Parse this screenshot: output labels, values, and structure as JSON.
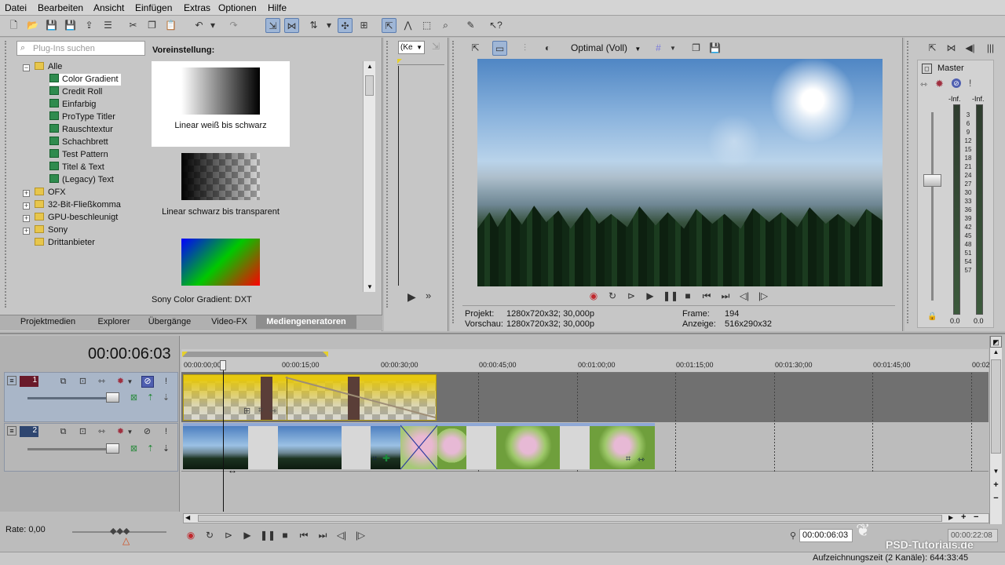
{
  "menu": [
    "Datei",
    "Bearbeiten",
    "Ansicht",
    "Einfügen",
    "Extras",
    "Optionen",
    "Hilfe"
  ],
  "explorer": {
    "search_placeholder": "Plug-Ins suchen",
    "tree_root": "Alle",
    "generators": [
      "Color Gradient",
      "Credit Roll",
      "Einfarbig",
      "ProType Titler",
      "Rauschtextur",
      "Schachbrett",
      "Test Pattern",
      "Titel & Text",
      "(Legacy) Text"
    ],
    "folders": [
      "OFX",
      "32-Bit-Fließkomma",
      "GPU-beschleunigt",
      "Sony",
      "Drittanbieter"
    ],
    "preset_heading": "Voreinstellung:",
    "presets": [
      "Linear weiß bis schwarz",
      "Linear schwarz bis transparent"
    ],
    "plugin_name": "Sony Color Gradient: DXT",
    "tabs": [
      "Projektmedien",
      "Explorer",
      "Übergänge",
      "Video-FX",
      "Mediengeneratoren"
    ],
    "active_tab": "Mediengeneratoren"
  },
  "trimmer": {
    "dropdown_label": "(Ke"
  },
  "preview": {
    "quality": "Optimal (Voll)",
    "projekt_label": "Projekt:",
    "projekt_value": "1280x720x32; 30,000p",
    "vorschau_label": "Vorschau:",
    "vorschau_value": "1280x720x32; 30,000p",
    "frame_label": "Frame:",
    "frame_value": "194",
    "anzeige_label": "Anzeige:",
    "anzeige_value": "516x290x32"
  },
  "mixer": {
    "title": "Master",
    "inf_left": "-Inf.",
    "inf_right": "-Inf.",
    "scale": [
      "3",
      "6",
      "9",
      "12",
      "15",
      "18",
      "21",
      "24",
      "27",
      "30",
      "33",
      "36",
      "39",
      "42",
      "45",
      "48",
      "51",
      "54",
      "57"
    ],
    "bottom_left": "0.0",
    "bottom_right": "0.0"
  },
  "timeline": {
    "timecode": "00:00:06:03",
    "ruler": [
      "00:00:00;00",
      "00:00:15;00",
      "00:00:30;00",
      "00:00:45;00",
      "00:01:00;00",
      "00:01:15;00",
      "00:01:30;00",
      "00:01:45;00",
      "00:02"
    ],
    "track1_number": "1",
    "track2_number": "2",
    "rate_label": "Rate: 0,00",
    "position_time": "00:00:06:03",
    "end_time": "00:00:22:08",
    "status": "Aufzeichnungszeit (2 Kanäle): 644:33:45",
    "watermark": "PSD-Tutorials.de"
  },
  "colors": {
    "accent": "#5b7db0",
    "event_yellow": "#e6c80f",
    "record_red": "#c0282d"
  }
}
